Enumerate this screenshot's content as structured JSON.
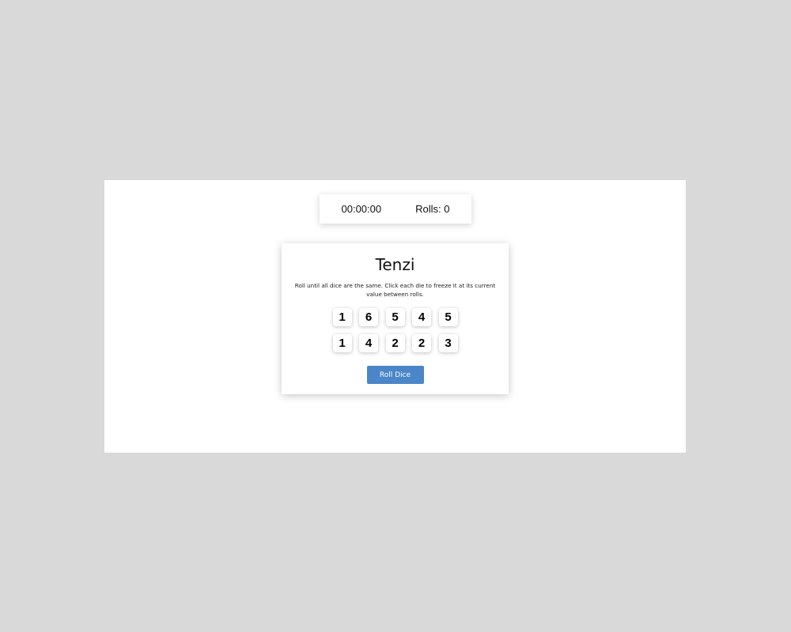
{
  "stats": {
    "timer": "00:00:00",
    "rolls": "Rolls: 0"
  },
  "game": {
    "title": "Tenzi",
    "instructions": "Roll until all dice are the same. Click each die to freeze it at its current value between rolls.",
    "dice": [
      "1",
      "6",
      "5",
      "4",
      "5",
      "1",
      "4",
      "2",
      "2",
      "3"
    ],
    "roll_button_label": "Roll Dice",
    "accent_color": "#4a86c8"
  }
}
